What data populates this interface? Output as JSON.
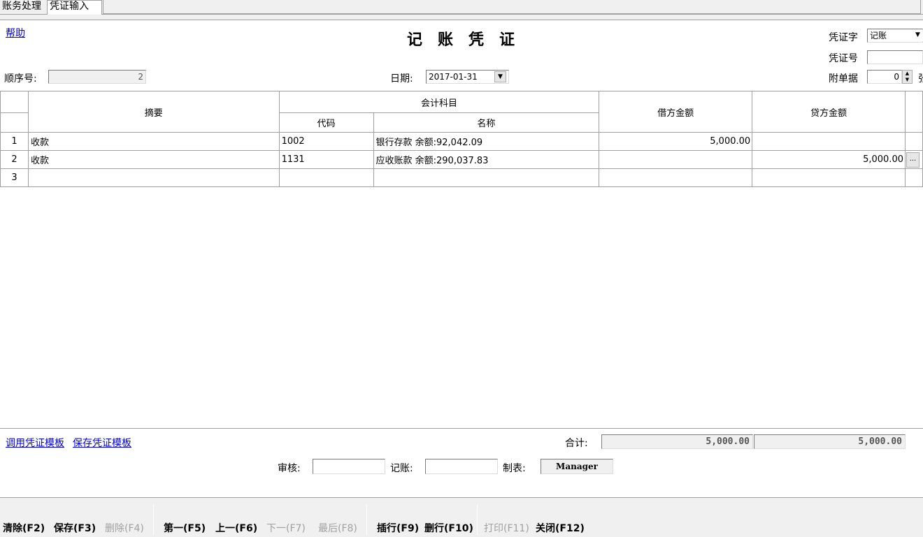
{
  "tabs": [
    {
      "label": "账务处理"
    },
    {
      "label": "凭证输入"
    }
  ],
  "header": {
    "help": "帮助",
    "title": "记账凭证",
    "seq_label": "顺序号:",
    "seq_value": "2",
    "date_label": "日期:",
    "date_value": "2017-01-31",
    "voucher_word_label": "凭证字",
    "voucher_word_value": "记账",
    "voucher_no_label": "凭证号",
    "voucher_no_value": "",
    "attach_label": "附单据",
    "attach_value": "0",
    "attach_suffix": "张"
  },
  "grid": {
    "headers": {
      "summary": "摘要",
      "account": "会计科目",
      "code": "代码",
      "name": "名称",
      "debit": "借方金额",
      "credit": "贷方金额"
    },
    "rows": [
      {
        "no": "1",
        "summary": "收款",
        "code": "1002",
        "name": "银行存款 余额:92,042.09",
        "debit": "5,000.00",
        "credit": ""
      },
      {
        "no": "2",
        "summary": "收款",
        "code": "1131",
        "name": "应收账款 余额:290,037.83",
        "debit": "",
        "credit": "5,000.00",
        "button": "..."
      },
      {
        "no": "3",
        "summary": "",
        "code": "",
        "name": "",
        "debit": "",
        "credit": ""
      }
    ]
  },
  "footer": {
    "use_template": "调用凭证模板",
    "save_template": "保存凭证模板",
    "total_label": "合计:",
    "total_debit": "5,000.00",
    "total_credit": "5,000.00",
    "review_label": "审核:",
    "review_value": "",
    "post_label": "记账:",
    "post_value": "",
    "maker_label": "制表:",
    "maker_value": "Manager"
  },
  "toolbar": {
    "clear": "清除(F2)",
    "save": "保存(F3)",
    "delete": "删除(F4)",
    "first": "第一(F5)",
    "prev": "上一(F6)",
    "next": "下一(F7)",
    "last": "最后(F8)",
    "insert_row": "插行(F9)",
    "delete_row": "删行(F10)",
    "print": "打印(F11)",
    "close": "关闭(F12)"
  }
}
